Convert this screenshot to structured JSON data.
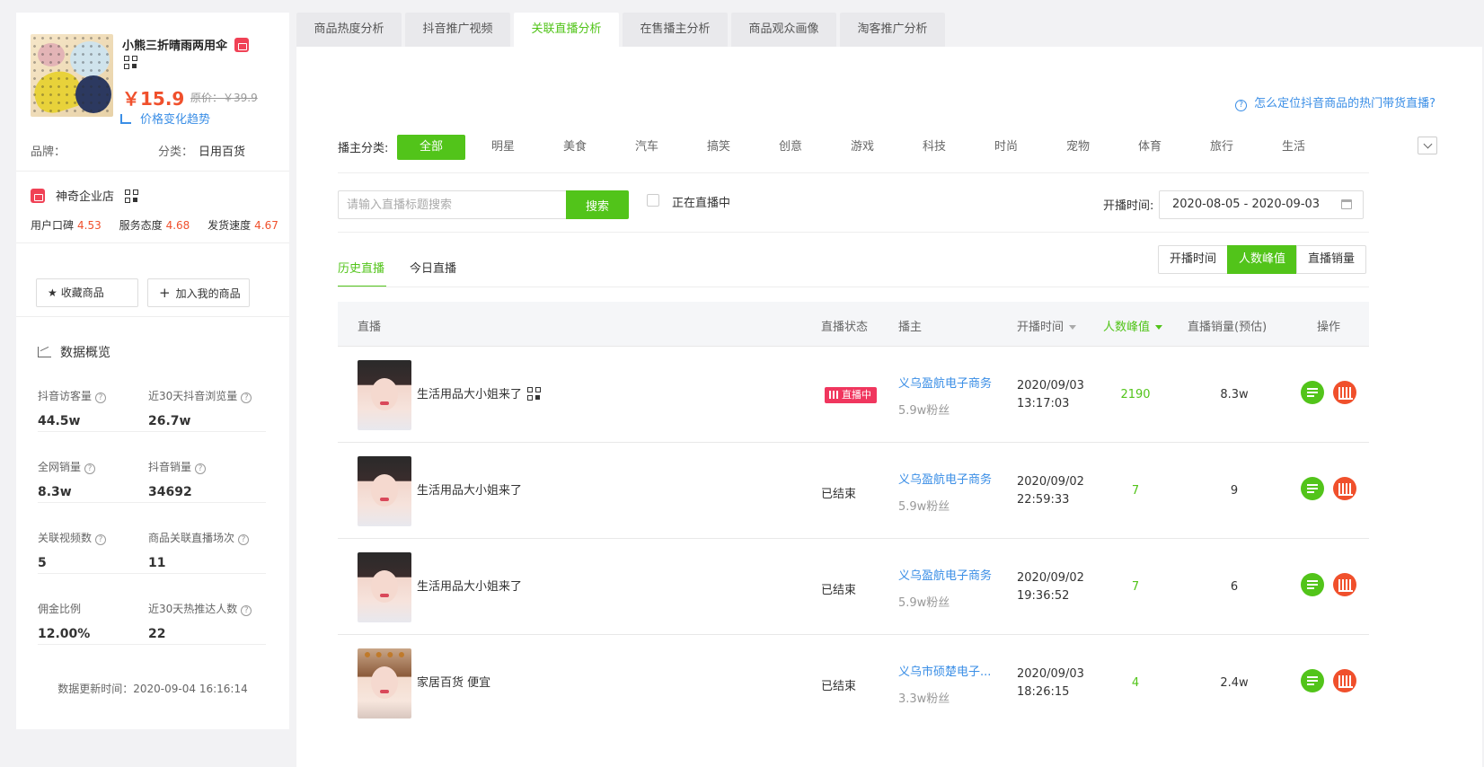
{
  "product": {
    "name": "小熊三折晴雨两用伞",
    "price": "￥15.9",
    "original_price": "原价：￥39.9",
    "price_trend_label": "价格变化趋势",
    "brand_label": "品牌：",
    "brand_value": "",
    "category_label": "分类：",
    "category_value": "日用百货"
  },
  "shop": {
    "name": "神奇企业店",
    "scores": [
      {
        "label": "用户口碑",
        "value": "4.53"
      },
      {
        "label": "服务态度",
        "value": "4.68"
      },
      {
        "label": "发货速度",
        "value": "4.67"
      }
    ]
  },
  "actions": {
    "favorite_label": "收藏商品",
    "add_label": "加入我的商品"
  },
  "overview": {
    "title": "数据概览",
    "stats": [
      {
        "label": "抖音访客量",
        "value": "44.5w"
      },
      {
        "label": "近30天抖音浏览量",
        "value": "26.7w"
      },
      {
        "label": "全网销量",
        "value": "8.3w"
      },
      {
        "label": "抖音销量",
        "value": "34692"
      },
      {
        "label": "关联视频数",
        "value": "5"
      },
      {
        "label": "商品关联直播场次",
        "value": "11"
      },
      {
        "label": "佣金比例",
        "value": "12.00%"
      },
      {
        "label": "近30天热推达人数",
        "value": "22"
      }
    ],
    "updated": "数据更新时间：2020-09-04 16:16:14"
  },
  "tabs": [
    "商品热度分析",
    "抖音推广视频",
    "关联直播分析",
    "在售播主分析",
    "商品观众画像",
    "淘客推广分析"
  ],
  "active_tab": "关联直播分析",
  "help_link": "怎么定位抖音商品的热门带货直播?",
  "filters": {
    "category_label": "播主分类:",
    "categories": [
      "全部",
      "明星",
      "美食",
      "汽车",
      "搞笑",
      "创意",
      "游戏",
      "科技",
      "时尚",
      "宠物",
      "体育",
      "旅行",
      "生活"
    ],
    "search_placeholder": "请输入直播标题搜索",
    "search_button": "搜索",
    "live_only_label": "正在直播中",
    "date_label": "开播时间:",
    "date_range": "2020-08-05 - 2020-09-03"
  },
  "subtabs": [
    "历史直播",
    "今日直播"
  ],
  "sort_buttons": [
    "开播时间",
    "人数峰值",
    "直播销量"
  ],
  "table": {
    "headers": [
      "直播",
      "直播状态",
      "播主",
      "开播时间",
      "人数峰值",
      "直播销量(预估)",
      "操作"
    ],
    "rows": [
      {
        "title": "生活用品大小姐来了",
        "status": "直播中",
        "host": "义乌盈航电子商务",
        "fans": "5.9w粉丝",
        "date": "2020/09/03",
        "time": "13:17:03",
        "peak": "2190",
        "sales": "8.3w"
      },
      {
        "title": "生活用品大小姐来了",
        "status": "已结束",
        "host": "义乌盈航电子商务",
        "fans": "5.9w粉丝",
        "date": "2020/09/02",
        "time": "22:59:33",
        "peak": "7",
        "sales": "9"
      },
      {
        "title": "生活用品大小姐来了",
        "status": "已结束",
        "host": "义乌盈航电子商务",
        "fans": "5.9w粉丝",
        "date": "2020/09/02",
        "time": "19:36:52",
        "peak": "7",
        "sales": "6"
      },
      {
        "title": "家居百货 便宜",
        "status": "已结束",
        "host": "义乌市硕楚电子...",
        "fans": "3.3w粉丝",
        "date": "2020/09/03",
        "time": "18:26:15",
        "peak": "4",
        "sales": "2.4w"
      }
    ]
  },
  "colors": {
    "accent": "#52c41a",
    "price": "#f0502c",
    "link": "#3a8ee6",
    "live_badge": "#f0365e"
  }
}
